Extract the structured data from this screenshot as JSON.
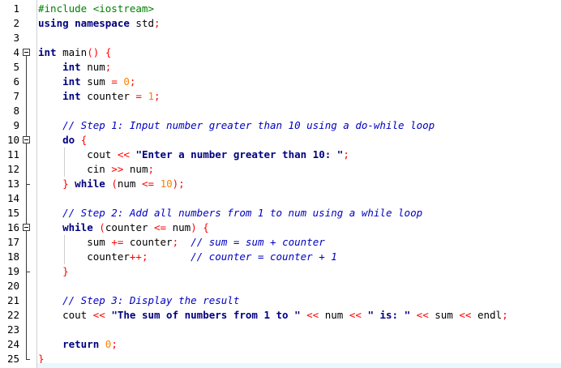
{
  "editor": {
    "line_numbers": [
      "1",
      "2",
      "3",
      "4",
      "5",
      "6",
      "7",
      "8",
      "9",
      "10",
      "11",
      "12",
      "13",
      "14",
      "15",
      "16",
      "17",
      "18",
      "19",
      "20",
      "21",
      "22",
      "23",
      "24",
      "25"
    ],
    "lines": [
      [
        {
          "t": "#include <iostream>",
          "c": "pp"
        }
      ],
      [
        {
          "t": "using namespace",
          "c": "kw"
        },
        {
          "t": " std",
          "c": ""
        },
        {
          "t": ";",
          "c": "op"
        }
      ],
      [],
      [
        {
          "t": "int",
          "c": "kw"
        },
        {
          "t": " main",
          "c": ""
        },
        {
          "t": "()",
          "c": "op"
        },
        {
          "t": " ",
          "c": ""
        },
        {
          "t": "{",
          "c": "br"
        }
      ],
      [
        {
          "t": "    ",
          "c": ""
        },
        {
          "t": "int",
          "c": "kw"
        },
        {
          "t": " num",
          "c": ""
        },
        {
          "t": ";",
          "c": "op"
        }
      ],
      [
        {
          "t": "    ",
          "c": ""
        },
        {
          "t": "int",
          "c": "kw"
        },
        {
          "t": " sum ",
          "c": ""
        },
        {
          "t": "=",
          "c": "op"
        },
        {
          "t": " ",
          "c": ""
        },
        {
          "t": "0",
          "c": "num"
        },
        {
          "t": ";",
          "c": "op"
        }
      ],
      [
        {
          "t": "    ",
          "c": ""
        },
        {
          "t": "int",
          "c": "kw"
        },
        {
          "t": " counter ",
          "c": ""
        },
        {
          "t": "=",
          "c": "op"
        },
        {
          "t": " ",
          "c": ""
        },
        {
          "t": "1",
          "c": "num"
        },
        {
          "t": ";",
          "c": "op"
        }
      ],
      [],
      [
        {
          "t": "    // Step 1: Input number greater than 10 using a do-while loop",
          "c": "cm"
        }
      ],
      [
        {
          "t": "    ",
          "c": ""
        },
        {
          "t": "do",
          "c": "kw"
        },
        {
          "t": " ",
          "c": ""
        },
        {
          "t": "{",
          "c": "br"
        }
      ],
      [
        {
          "t": "        cout ",
          "c": ""
        },
        {
          "t": "<<",
          "c": "op"
        },
        {
          "t": " ",
          "c": ""
        },
        {
          "t": "\"Enter a number greater than 10: \"",
          "c": "str"
        },
        {
          "t": ";",
          "c": "op"
        }
      ],
      [
        {
          "t": "        cin ",
          "c": ""
        },
        {
          "t": ">>",
          "c": "op"
        },
        {
          "t": " num",
          "c": ""
        },
        {
          "t": ";",
          "c": "op"
        }
      ],
      [
        {
          "t": "    ",
          "c": ""
        },
        {
          "t": "}",
          "c": "br"
        },
        {
          "t": " ",
          "c": ""
        },
        {
          "t": "while",
          "c": "kw"
        },
        {
          "t": " ",
          "c": ""
        },
        {
          "t": "(",
          "c": "op"
        },
        {
          "t": "num ",
          "c": ""
        },
        {
          "t": "<=",
          "c": "op"
        },
        {
          "t": " ",
          "c": ""
        },
        {
          "t": "10",
          "c": "num"
        },
        {
          "t": ");",
          "c": "op"
        }
      ],
      [],
      [
        {
          "t": "    // Step 2: Add all numbers from 1 to num using a while loop",
          "c": "cm"
        }
      ],
      [
        {
          "t": "    ",
          "c": ""
        },
        {
          "t": "while",
          "c": "kw"
        },
        {
          "t": " ",
          "c": ""
        },
        {
          "t": "(",
          "c": "op"
        },
        {
          "t": "counter ",
          "c": ""
        },
        {
          "t": "<=",
          "c": "op"
        },
        {
          "t": " num",
          "c": ""
        },
        {
          "t": ")",
          "c": "op"
        },
        {
          "t": " ",
          "c": ""
        },
        {
          "t": "{",
          "c": "br"
        }
      ],
      [
        {
          "t": "        sum ",
          "c": ""
        },
        {
          "t": "+=",
          "c": "op"
        },
        {
          "t": " counter",
          "c": ""
        },
        {
          "t": ";",
          "c": "op"
        },
        {
          "t": "  ",
          "c": ""
        },
        {
          "t": "// sum = sum + counter",
          "c": "cm"
        }
      ],
      [
        {
          "t": "        counter",
          "c": ""
        },
        {
          "t": "++;",
          "c": "op"
        },
        {
          "t": "       ",
          "c": ""
        },
        {
          "t": "// counter = counter + 1",
          "c": "cm"
        }
      ],
      [
        {
          "t": "    ",
          "c": ""
        },
        {
          "t": "}",
          "c": "br"
        }
      ],
      [],
      [
        {
          "t": "    // Step 3: Display the result",
          "c": "cm"
        }
      ],
      [
        {
          "t": "    cout ",
          "c": ""
        },
        {
          "t": "<<",
          "c": "op"
        },
        {
          "t": " ",
          "c": ""
        },
        {
          "t": "\"The sum of numbers from 1 to \"",
          "c": "str"
        },
        {
          "t": " ",
          "c": ""
        },
        {
          "t": "<<",
          "c": "op"
        },
        {
          "t": " num ",
          "c": ""
        },
        {
          "t": "<<",
          "c": "op"
        },
        {
          "t": " ",
          "c": ""
        },
        {
          "t": "\" is: \"",
          "c": "str"
        },
        {
          "t": " ",
          "c": ""
        },
        {
          "t": "<<",
          "c": "op"
        },
        {
          "t": " sum ",
          "c": ""
        },
        {
          "t": "<<",
          "c": "op"
        },
        {
          "t": " endl",
          "c": ""
        },
        {
          "t": ";",
          "c": "op"
        }
      ],
      [],
      [
        {
          "t": "    ",
          "c": ""
        },
        {
          "t": "return",
          "c": "kw"
        },
        {
          "t": " ",
          "c": ""
        },
        {
          "t": "0",
          "c": "num"
        },
        {
          "t": ";",
          "c": "op"
        }
      ],
      [
        {
          "t": "}",
          "c": "br"
        }
      ]
    ]
  },
  "colors": {
    "keyword": "#000080",
    "string": "#000080",
    "comment": "#0000c0",
    "number": "#ff8000",
    "operator": "#ff0000",
    "preprocessor": "#008000"
  }
}
